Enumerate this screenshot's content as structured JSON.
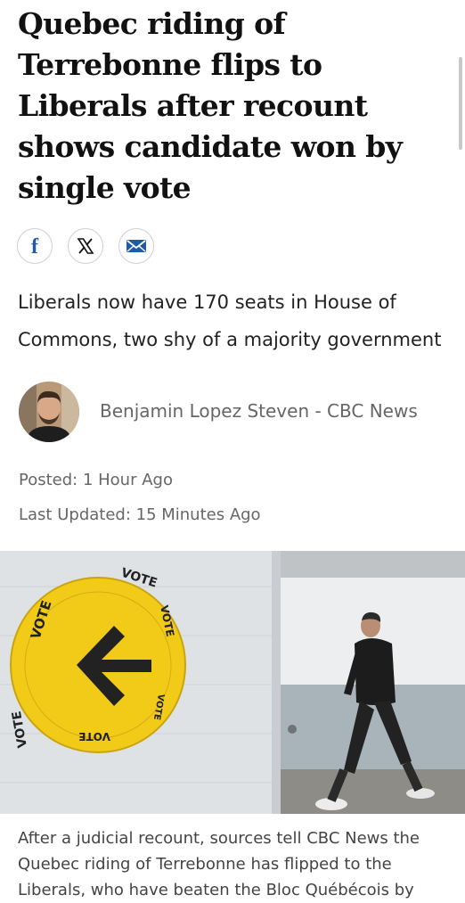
{
  "article": {
    "headline": "Quebec riding of Terrebonne flips to Liberals after recount shows candidate won by single vote",
    "subheadline": "Liberals now have 170 seats in House of Commons, two shy of a majority government",
    "author": "Benjamin Lopez Steven - CBC News",
    "posted": "Posted: 1 Hour Ago",
    "updated": "Last Updated: 15 Minutes Ago",
    "body_start": "After a judicial recount, sources tell CBC News the Quebec riding of Terrebonne has flipped to the Liberals, who have beaten the Bloc Québécois by"
  },
  "share": {
    "icons": [
      "facebook-icon",
      "x-icon",
      "email-icon"
    ],
    "facebook_glyph": "f"
  },
  "photo": {
    "sign_text": "VOTE",
    "icons": [
      "vote-sign",
      "arrow-icon",
      "walking-person"
    ]
  },
  "colors": {
    "headline": "#111111",
    "text": "#222222",
    "muted": "#666666",
    "sign_yellow": "#f2cb19",
    "facebook_blue": "#1f5aa6",
    "email_blue": "#1f5aa6"
  }
}
